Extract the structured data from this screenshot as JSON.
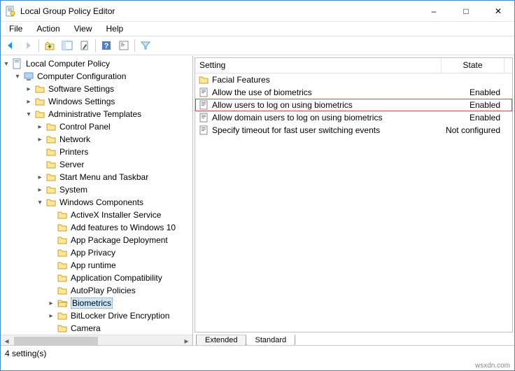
{
  "window": {
    "title": "Local Group Policy Editor"
  },
  "menu": {
    "file": "File",
    "action": "Action",
    "view": "View",
    "help": "Help"
  },
  "tree": {
    "root": "Local Computer Policy",
    "cc": "Computer Configuration",
    "ss": "Software Settings",
    "ws": "Windows Settings",
    "at": "Administrative Templates",
    "cp": "Control Panel",
    "net": "Network",
    "printers": "Printers",
    "server": "Server",
    "start": "Start Menu and Taskbar",
    "system": "System",
    "wc": "Windows Components",
    "ax": "ActiveX Installer Service",
    "af10": "Add features to Windows 10",
    "apd": "App Package Deployment",
    "apriv": "App Privacy",
    "aruntime": "App runtime",
    "appcompat": "Application Compatibility",
    "autoplay": "AutoPlay Policies",
    "biometrics": "Biometrics",
    "bitlocker": "BitLocker Drive Encryption",
    "camera": "Camera"
  },
  "list": {
    "header_setting": "Setting",
    "header_state": "State",
    "rows": [
      {
        "type": "folder",
        "name": "Facial Features",
        "state": ""
      },
      {
        "type": "policy",
        "name": "Allow the use of biometrics",
        "state": "Enabled"
      },
      {
        "type": "policy",
        "name": "Allow users to log on using biometrics",
        "state": "Enabled",
        "highlight": true
      },
      {
        "type": "policy",
        "name": "Allow domain users to log on using biometrics",
        "state": "Enabled"
      },
      {
        "type": "policy",
        "name": "Specify timeout for fast user switching events",
        "state": "Not configured"
      }
    ]
  },
  "tabs": {
    "extended": "Extended",
    "standard": "Standard"
  },
  "statusbar": "4 setting(s)",
  "watermark": "wsxdn.com"
}
